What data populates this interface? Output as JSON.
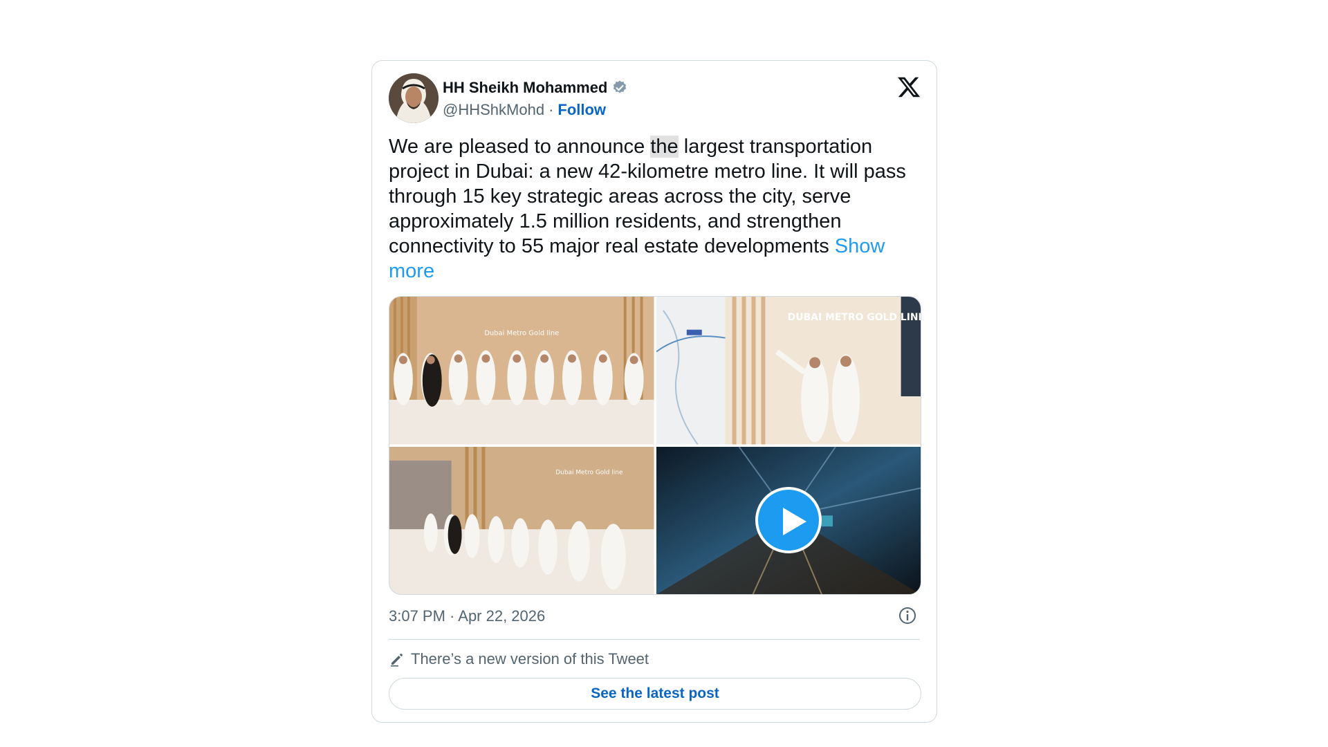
{
  "author": {
    "name": "HH Sheikh Mohammed",
    "handle": "@HHShkMohd",
    "separator": "·",
    "follow_label": "Follow",
    "verified": true
  },
  "tweet": {
    "text_before": "We are pleased to announce ",
    "text_highlight": "the",
    "text_after": " largest transportation project in Dubai: a new 42-kilometre metro line. It will pass through 15 key strategic areas across the city, serve approximately 1.5 million residents, and strengthen connectivity to 55 major real estate developments ",
    "show_more_label": "Show more"
  },
  "media": {
    "photo_1_sign": "Dubai Metro Gold line",
    "photo_2_sign": "DUBAI METRO GOLD LINE",
    "photo_3_sign": "Dubai Metro Gold line",
    "video_has_play_button": true
  },
  "footer": {
    "timestamp": "3:07 PM · Apr 22, 2026",
    "new_version_text": "There’s a new version of this Tweet",
    "latest_post_label": "See the latest post"
  },
  "colors": {
    "accent": "#1d9bf0",
    "link_dark": "#0a66c2",
    "text": "#0f1419",
    "muted": "#536471",
    "border": "#cfd9de"
  },
  "icons": [
    "verified-badge-icon",
    "x-logo-icon",
    "play-icon",
    "info-icon",
    "pencil-icon"
  ]
}
